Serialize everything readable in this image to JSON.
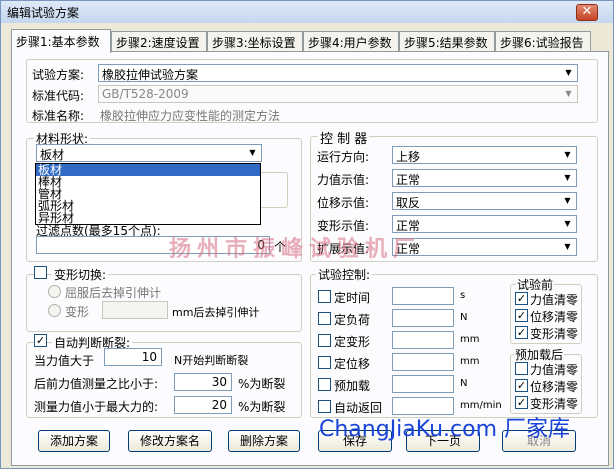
{
  "window": {
    "title": "编辑试验方案",
    "close": "✕"
  },
  "tabs": [
    "步骤1:基本参数",
    "步骤2:速度设置",
    "步骤3:坐标设置",
    "步骤4:用户参数",
    "步骤5:结果参数",
    "步骤6:试验报告"
  ],
  "scheme": {
    "label": "试验方案:",
    "value": "橡胶拉伸试验方案",
    "code_label": "标准代码:",
    "code_value": "GB/T528-2009",
    "name_label": "标准名称:",
    "name_value": "橡胶拉伸应力应变性能的测定方法"
  },
  "material": {
    "label": "材料形状:",
    "value": "板材",
    "options": [
      "板材",
      "棒材",
      "管材",
      "弧形材",
      "异形材"
    ],
    "points_label": "过滤点数(最多15个点):",
    "points_value": "0",
    "points_unit": "个"
  },
  "control": {
    "title": "控 制 器",
    "rows": [
      {
        "label": "运行方向:",
        "value": "上移"
      },
      {
        "label": "力值示值:",
        "value": "正常"
      },
      {
        "label": "位移示值:",
        "value": "取反"
      },
      {
        "label": "变形示值:",
        "value": "正常"
      },
      {
        "label": "扩展示值:",
        "value": "正常"
      }
    ]
  },
  "deform": {
    "label": "变形切换:",
    "opt1": "屈服后去掉引伸计",
    "opt2": "变形",
    "opt2_suffix": "mm后去掉引伸计"
  },
  "autobreak": {
    "label": "自动判断断裂:",
    "rows": [
      {
        "label": "当力值大于",
        "value": "10",
        "suffix": "N开始判断断裂"
      },
      {
        "label": "后前力值测量之比小于:",
        "value": "30",
        "suffix": "%为断裂"
      },
      {
        "label": "测量力值小于最大力的:",
        "value": "20",
        "suffix": "%为断裂"
      }
    ]
  },
  "testctrl": {
    "title": "试验控制:",
    "rows": [
      {
        "label": "定时间",
        "unit": "s"
      },
      {
        "label": "定负荷",
        "unit": "N"
      },
      {
        "label": "定变形",
        "unit": "mm"
      },
      {
        "label": "定位移",
        "unit": "mm"
      },
      {
        "label": "预加载",
        "unit": "N"
      },
      {
        "label": "自动返回",
        "unit": "mm/min"
      }
    ]
  },
  "pretest": {
    "title": "试验前",
    "items": [
      {
        "label": "力值清零",
        "checked": true
      },
      {
        "label": "位移清零",
        "checked": true
      },
      {
        "label": "变形清零",
        "checked": true
      }
    ]
  },
  "afterpre": {
    "title": "预加载后",
    "items": [
      {
        "label": "力值清零",
        "checked": false
      },
      {
        "label": "位移清零",
        "checked": true
      },
      {
        "label": "变形清零",
        "checked": true
      }
    ]
  },
  "buttons": {
    "add": "添加方案",
    "rename": "修改方案名",
    "delete": "删除方案",
    "save": "保存",
    "next": "下一页",
    "cancel": "取消"
  },
  "watermark": {
    "line1": "扬州市振峰试验机厂",
    "line2": "ChangJiaKu.com 厂家库"
  }
}
